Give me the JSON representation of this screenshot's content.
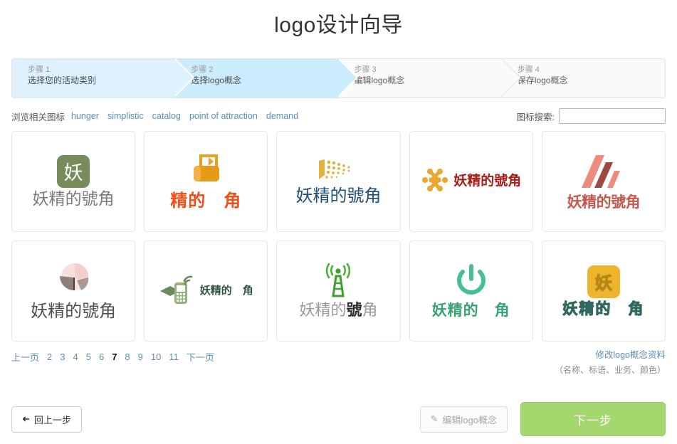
{
  "page": {
    "title": "logo设计向导"
  },
  "steps": [
    {
      "num": "步骤 1",
      "label": "选择您的活动类别",
      "state": "done"
    },
    {
      "num": "步骤 2",
      "label": "选择logo概念",
      "state": "active"
    },
    {
      "num": "步骤 3",
      "label": "编辑logo概念",
      "state": "idle"
    },
    {
      "num": "步骤 4",
      "label": "保存logo概念",
      "state": "idle"
    }
  ],
  "toolbar": {
    "tags_label": "浏览相关图标",
    "tags": [
      "hunger",
      "simplistic",
      "catalog",
      "point of attraction",
      "demand"
    ],
    "search_label": "图标搜索:",
    "search_value": "",
    "search_placeholder": ""
  },
  "logos": [
    {
      "id": "logo-1",
      "brand": "妖精的號角",
      "mark": "badge-green-yao",
      "mark_char": "妖",
      "style": "t-grey",
      "layout": "stack"
    },
    {
      "id": "logo-2",
      "brand": "精的　角",
      "mark": "shopping-bag-icon",
      "style": "t-orange",
      "layout": "stack"
    },
    {
      "id": "logo-3",
      "brand": "妖精的號角",
      "mark": "dotted-flag-icon",
      "style": "t-navy",
      "layout": "stack"
    },
    {
      "id": "logo-4",
      "brand": "妖精的號角",
      "mark": "knot-icon",
      "style": "t-darkred",
      "layout": "row"
    },
    {
      "id": "logo-5",
      "brand": "妖精的號角",
      "mark": "triangle-strokes-icon",
      "style": "t-brick",
      "layout": "stack"
    },
    {
      "id": "logo-6",
      "brand": "妖精的號角",
      "mark": "pie-chart-icon",
      "style": "t-dark",
      "layout": "stack"
    },
    {
      "id": "logo-7",
      "brand": "妖精的　角",
      "mark": "mobile-mail-icon",
      "style": "t-dkgreen",
      "layout": "row"
    },
    {
      "id": "logo-8",
      "brand": "妖精的號角",
      "mark": "radio-tower-icon",
      "style": "t-mixed",
      "layout": "stack",
      "bold_part": "號"
    },
    {
      "id": "logo-9",
      "brand": "妖精的　角",
      "mark": "power-button-icon",
      "style": "t-green",
      "layout": "stack"
    },
    {
      "id": "logo-10",
      "brand": "妖精的　角",
      "mark": "badge-amber-yao",
      "mark_char": "妖",
      "style": "t-outline",
      "layout": "stack"
    }
  ],
  "pagination": {
    "prev": "上一页",
    "next": "下一页",
    "pages": [
      "2",
      "3",
      "4",
      "5",
      "6",
      "7",
      "8",
      "9",
      "10",
      "11"
    ],
    "current": "7"
  },
  "modify": {
    "link": "修改logo概念资料",
    "sub": "（名称、标语、业务、颜色）"
  },
  "footer": {
    "back_label": "回上一步",
    "back_icon": "arrow-left-icon",
    "edit_label": "编辑logo概念",
    "edit_icon": "pencil-icon",
    "next_label": "下一步"
  },
  "colors": {
    "step_done": "#def1fd",
    "step_active": "#cbecfd",
    "step_idle": "#fafafa",
    "link": "#5e8fb5",
    "next_button": "#a4d86e"
  }
}
